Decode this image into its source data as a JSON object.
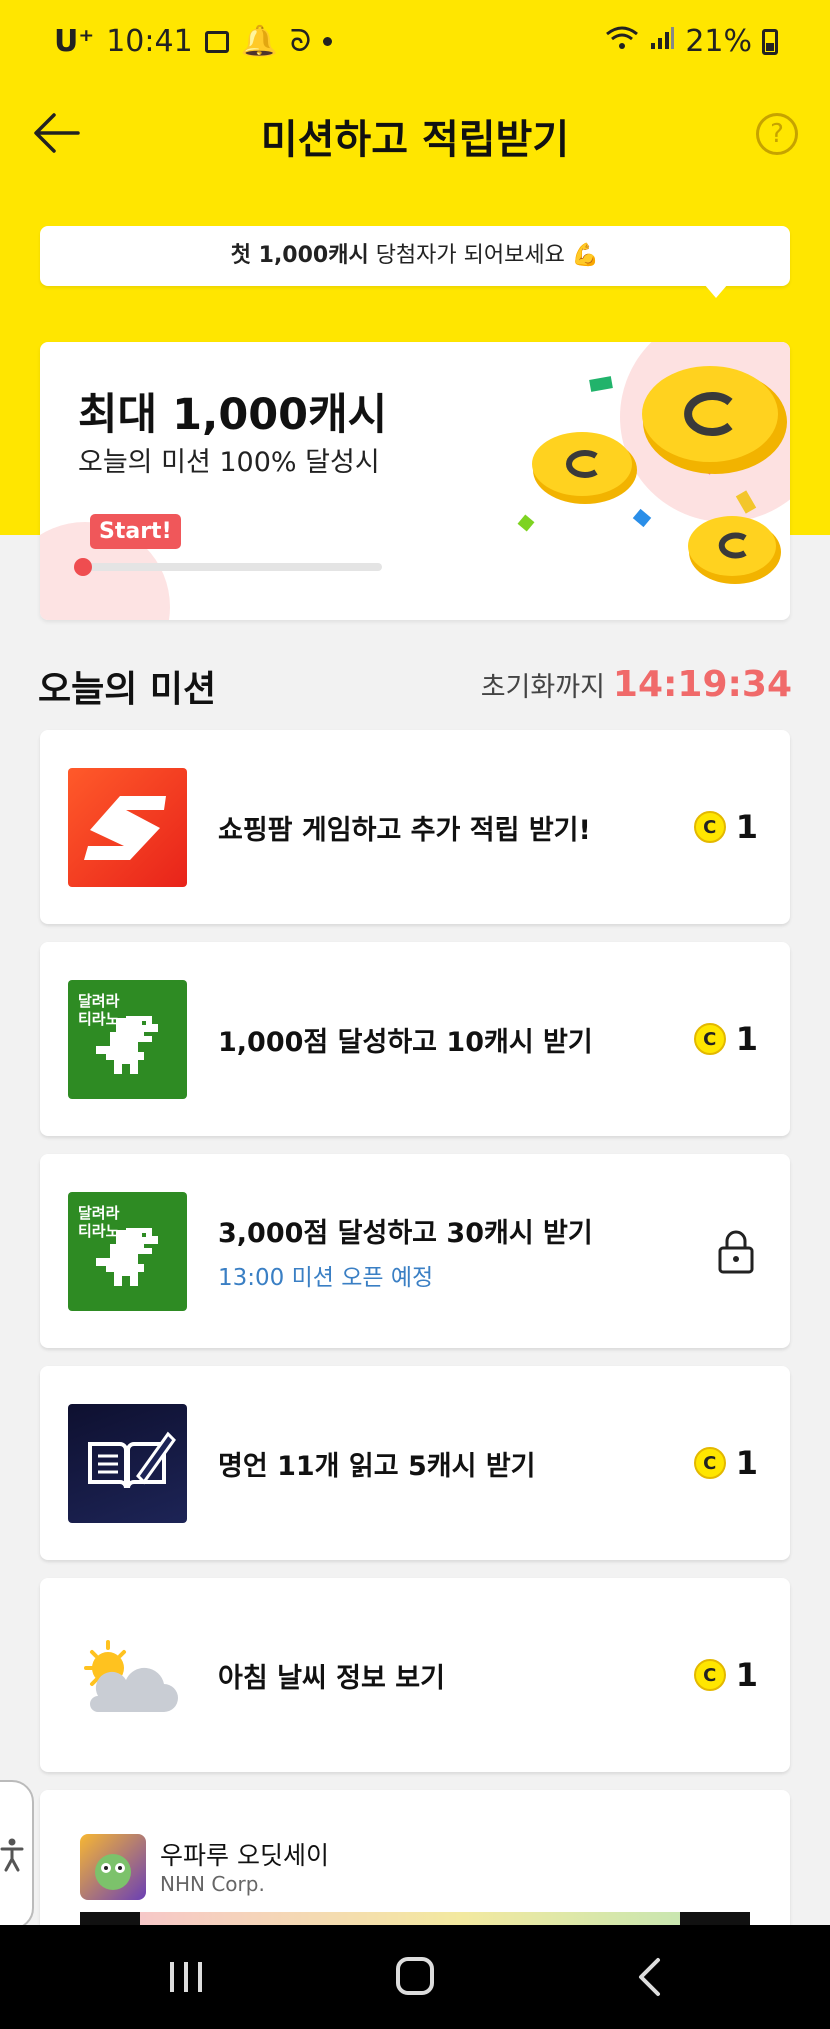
{
  "status_bar": {
    "carrier": "U⁺",
    "time": "10:41",
    "battery": "21%"
  },
  "header": {
    "title": "미션하고 적립받기",
    "help_glyph": "?"
  },
  "tooltip": {
    "bold": "첫 1,000캐시",
    "rest": " 당첨자가 되어보세요 💪"
  },
  "promo": {
    "title": "최대 1,000캐시",
    "subtitle": "오늘의 미션 100% 달성시",
    "badge": "Start!",
    "progress": 0
  },
  "section": {
    "title": "오늘의 미션",
    "reset_label": "초기화까지",
    "reset_time": "14:19:34"
  },
  "missions": [
    {
      "label": "쇼핑팜 게임하고 추가 적립 받기!",
      "sub": "",
      "reward": "1",
      "icon": "shopping-farm-icon",
      "locked": false
    },
    {
      "label": "1,000점 달성하고 10캐시 받기",
      "sub": "",
      "reward": "1",
      "icon": "dino-run-icon",
      "thumb_text": "달려라\n티라노",
      "locked": false
    },
    {
      "label": "3,000점 달성하고 30캐시 받기",
      "sub": "13:00 미션 오픈 예정",
      "reward": "",
      "icon": "dino-run-icon",
      "thumb_text": "달려라\n티라노",
      "locked": true
    },
    {
      "label": "명언 11개 읽고 5캐시 받기",
      "sub": "",
      "reward": "1",
      "icon": "book-quote-icon",
      "locked": false
    },
    {
      "label": "아침 날씨 정보 보기",
      "sub": "",
      "reward": "1",
      "icon": "weather-icon",
      "locked": false
    }
  ],
  "coin_glyph": "C",
  "ad": {
    "app_name": "우파루 오딧세이",
    "company": "NHN Corp."
  },
  "colors": {
    "brand_yellow": "#ffe600",
    "timer_red": "#f06a6a",
    "start_red": "#f0575a",
    "link_blue": "#3a7fc4"
  }
}
